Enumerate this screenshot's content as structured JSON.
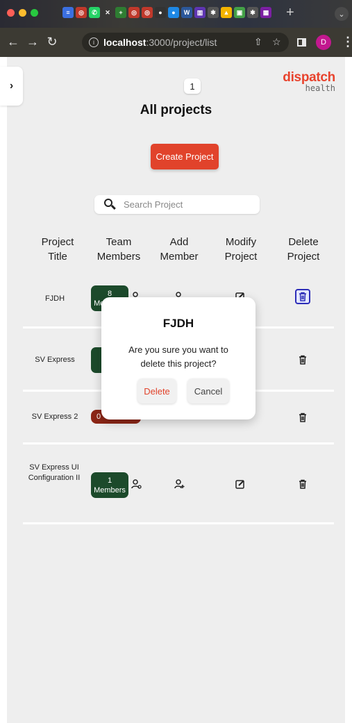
{
  "browser": {
    "url_host": "localhost",
    "url_path": ":3000/project/list",
    "profile_initial": "D",
    "tab_icons": [
      {
        "name": "docs-tab-icon",
        "color": "#3b6fe0",
        "glyph": "≡"
      },
      {
        "name": "app-tab-icon",
        "color": "#c0392b",
        "glyph": "◎"
      },
      {
        "name": "whatsapp-tab-icon",
        "color": "#25d366",
        "glyph": "✆"
      },
      {
        "name": "close-tab-icon",
        "color": "transparent",
        "glyph": "✕"
      },
      {
        "name": "plus-tab-icon",
        "color": "#2e7d32",
        "glyph": "+"
      },
      {
        "name": "app-tab-icon",
        "color": "#c0392b",
        "glyph": "◎"
      },
      {
        "name": "app-tab-icon",
        "color": "#c0392b",
        "glyph": "◎"
      },
      {
        "name": "github-tab-icon",
        "color": "#333333",
        "glyph": "●"
      },
      {
        "name": "chat-tab-icon",
        "color": "#1e88e5",
        "glyph": "●"
      },
      {
        "name": "word-tab-icon",
        "color": "#2b579a",
        "glyph": "W"
      },
      {
        "name": "chart-tab-icon",
        "color": "#5e35b1",
        "glyph": "▥"
      },
      {
        "name": "settings-tab-icon",
        "color": "#555555",
        "glyph": "✱"
      },
      {
        "name": "drive-tab-icon",
        "color": "#f4b400",
        "glyph": "▲"
      },
      {
        "name": "image-tab-icon",
        "color": "#43a047",
        "glyph": "▣"
      },
      {
        "name": "settings-tab-icon",
        "color": "#555555",
        "glyph": "✱"
      },
      {
        "name": "calendar-tab-icon",
        "color": "#7b1fa2",
        "glyph": "▦"
      }
    ]
  },
  "logo": {
    "main": "dispatch",
    "sub": "health"
  },
  "pagination": {
    "current": "1"
  },
  "page_title": "All projects",
  "create_button": "Create Project",
  "search": {
    "placeholder": "Search Project"
  },
  "table": {
    "headers": [
      {
        "line1": "Project",
        "line2": "Title"
      },
      {
        "line1": "Team",
        "line2": "Members"
      },
      {
        "line1": "Add",
        "line2": "Member"
      },
      {
        "line1": "Modify",
        "line2": "Project"
      },
      {
        "line1": "Delete",
        "line2": "Project"
      }
    ],
    "rows": [
      {
        "title": "FJDH",
        "members_count": "8",
        "members_label": "Members"
      },
      {
        "title": "SV Express",
        "members_count": "",
        "members_label": "Me"
      },
      {
        "title": "SV Express 2",
        "members_count": "0",
        "members_label": ""
      },
      {
        "title": "SV Express UI Configuration II",
        "members_count": "1",
        "members_label": "Members"
      }
    ]
  },
  "modal": {
    "title": "FJDH",
    "message": "Are you sure you want to delete this project?",
    "delete_label": "Delete",
    "cancel_label": "Cancel"
  },
  "colors": {
    "brand": "#e1432b",
    "badge_green": "#1c4a2b",
    "badge_red": "#8c2616",
    "highlight_trash": "#2d2db8"
  }
}
